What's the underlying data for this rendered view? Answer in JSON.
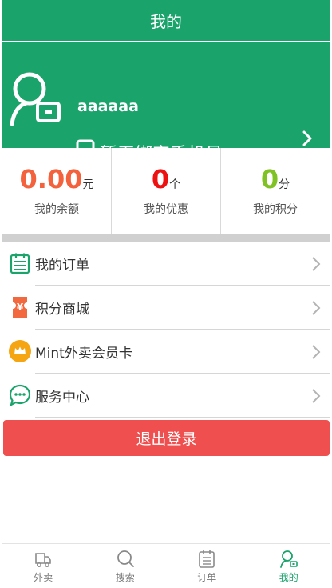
{
  "header": {
    "title": "我的"
  },
  "profile": {
    "username": "aaaaaa",
    "phone_status": "暂无绑定手机号",
    "avatar_icon": "user-icon",
    "phone_icon": "mobile-phone-icon",
    "chevron_icon": "chevron-right-icon"
  },
  "stats": [
    {
      "value": "0.00",
      "unit": "元",
      "caption": "我的余额",
      "color": "#f3623c"
    },
    {
      "value": "0",
      "unit": "个",
      "caption": "我的优惠",
      "color": "#ee1111"
    },
    {
      "value": "0",
      "unit": "分",
      "caption": "我的积分",
      "color": "#80c223"
    }
  ],
  "menu": [
    {
      "label": "我的订单",
      "icon": "order-list-icon"
    },
    {
      "label": "积分商城",
      "icon": "points-ticket-icon"
    },
    {
      "label": "Mint外卖会员卡",
      "icon": "crown-icon"
    },
    {
      "label": "服务中心",
      "icon": "chat-bubble-icon"
    }
  ],
  "logout_label": "退出登录",
  "tabbar": [
    {
      "label": "外卖",
      "icon": "delivery-truck-icon",
      "active": false
    },
    {
      "label": "搜索",
      "icon": "search-icon",
      "active": false
    },
    {
      "label": "订单",
      "icon": "order-list-icon",
      "active": false
    },
    {
      "label": "我的",
      "icon": "user-icon",
      "active": true
    }
  ],
  "colors": {
    "brand": "#1aa36b",
    "logout": "#ef4f4f",
    "inactive_tab": "#888888"
  }
}
